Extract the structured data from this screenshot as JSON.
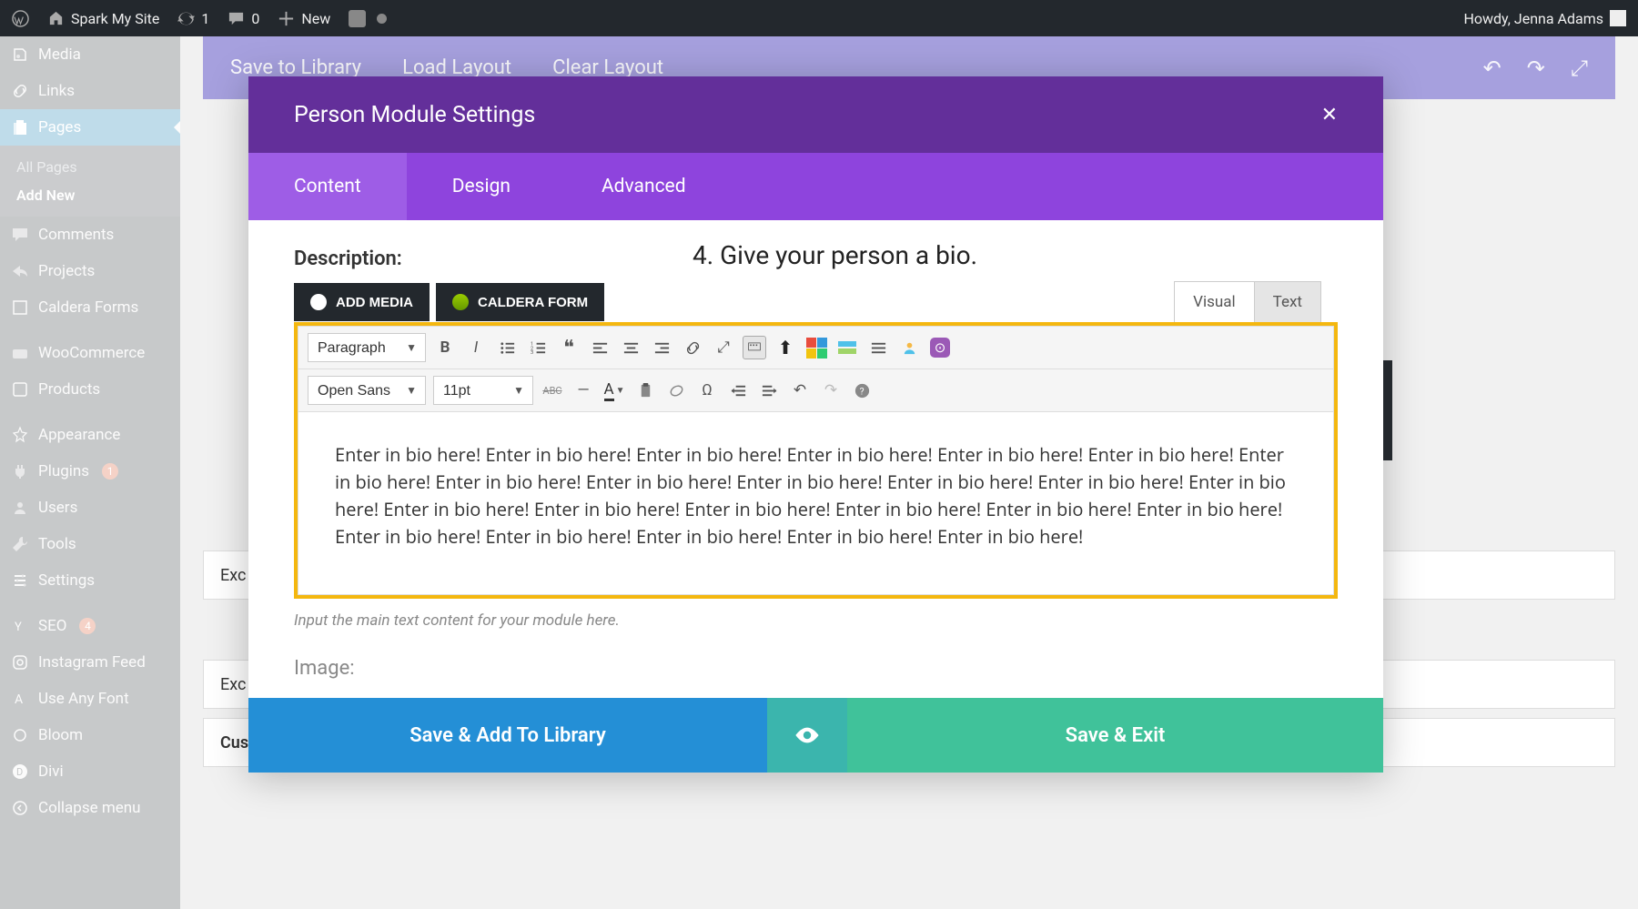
{
  "adminbar": {
    "site_name": "Spark My Site",
    "updates": "1",
    "comments": "0",
    "new_label": "New",
    "greeting": "Howdy, Jenna Adams"
  },
  "sidebar": {
    "items": [
      {
        "label": "Media",
        "icon": "media"
      },
      {
        "label": "Links",
        "icon": "links"
      },
      {
        "label": "Pages",
        "icon": "pages",
        "active": true
      },
      {
        "label": "Comments",
        "icon": "comments"
      },
      {
        "label": "Projects",
        "icon": "projects"
      },
      {
        "label": "Caldera Forms",
        "icon": "caldera"
      },
      {
        "label": "WooCommerce",
        "icon": "woo"
      },
      {
        "label": "Products",
        "icon": "products"
      },
      {
        "label": "Appearance",
        "icon": "appearance"
      },
      {
        "label": "Plugins",
        "icon": "plugins",
        "badge": "1"
      },
      {
        "label": "Users",
        "icon": "users"
      },
      {
        "label": "Tools",
        "icon": "tools"
      },
      {
        "label": "Settings",
        "icon": "settings"
      },
      {
        "label": "SEO",
        "icon": "seo",
        "badge": "4"
      },
      {
        "label": "Instagram Feed",
        "icon": "instagram"
      },
      {
        "label": "Use Any Font",
        "icon": "font"
      },
      {
        "label": "Bloom",
        "icon": "bloom"
      },
      {
        "label": "Divi",
        "icon": "divi"
      },
      {
        "label": "Collapse menu",
        "icon": "collapse"
      }
    ],
    "submenu": {
      "all": "All Pages",
      "add": "Add New"
    }
  },
  "builder_bar": {
    "save_library": "Save to Library",
    "load_layout": "Load Layout",
    "clear_layout": "Clear Layout"
  },
  "background_boxes": {
    "exc1": "Exc",
    "exc2": "Exc",
    "custom": "Custom Fields"
  },
  "modal": {
    "title": "Person Module Settings",
    "tabs": {
      "content": "Content",
      "design": "Design",
      "advanced": "Advanced"
    },
    "field_label": "Description:",
    "instruction": "4. Give your person a bio.",
    "add_media": "ADD MEDIA",
    "caldera_form": "CALDERA FORM",
    "editor_tabs": {
      "visual": "Visual",
      "text": "Text"
    },
    "toolbar": {
      "format_select": "Paragraph",
      "font_select": "Open Sans",
      "size_select": "11pt",
      "abc": "ABC"
    },
    "bio_text": "Enter in bio here! Enter in bio here! Enter in bio here! Enter in bio here! Enter in bio here! Enter in bio here! Enter in bio here! Enter in bio here! Enter in bio here! Enter in bio here! Enter in bio here! Enter in bio here! Enter in bio here! Enter in bio here! Enter in bio here! Enter in bio here! Enter in bio here! Enter in bio here! Enter in bio here! Enter in bio here! Enter in bio here! Enter in bio here! Enter in bio here! Enter in bio here!",
    "hint": "Input the main text content for your module here.",
    "next_field": "Image:",
    "footer": {
      "save_lib": "Save & Add To Library",
      "save_exit": "Save & Exit"
    }
  }
}
